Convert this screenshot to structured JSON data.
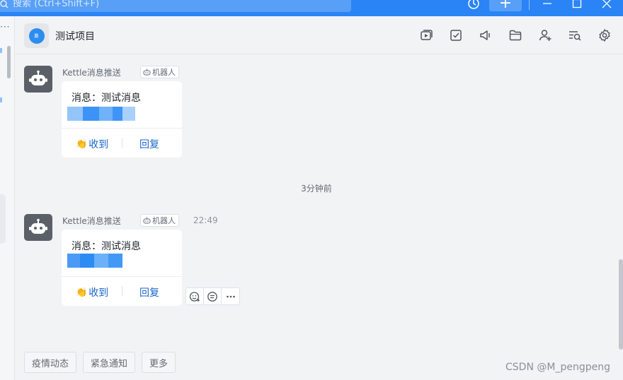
{
  "titlebar": {
    "search_placeholder": "搜索 (Ctrl+Shift+F)",
    "add_label": "+"
  },
  "header": {
    "group_avatar_text": "鹏",
    "title": "测试项目",
    "icons": [
      "screen-share-icon",
      "task-check-icon",
      "announcement-icon",
      "folder-icon",
      "add-member-icon",
      "search-history-icon",
      "settings-icon"
    ]
  },
  "messages": [
    {
      "sender": "Kettle消息推送",
      "robot_tag": "机器人",
      "time": "",
      "text": "消息：测试消息",
      "ack_label": "收到",
      "reply_label": "回复"
    },
    {
      "sender": "Kettle消息推送",
      "robot_tag": "机器人",
      "time": "22:49",
      "text": "消息：测试消息",
      "ack_label": "收到",
      "reply_label": "回复"
    }
  ],
  "timestamp_divider": "3分钟前",
  "reactions": [
    "add-emoji-icon",
    "reply-thread-icon",
    "more-icon"
  ],
  "quick_replies": [
    "疫情动态",
    "紧急通知",
    "更多"
  ],
  "watermark": "CSDN @M_pengpeng",
  "colors": {
    "titlebar": "#2a84f5",
    "link": "#1a66c8",
    "avatar_bot": "#5b6068",
    "background": "#f2f3f5"
  }
}
